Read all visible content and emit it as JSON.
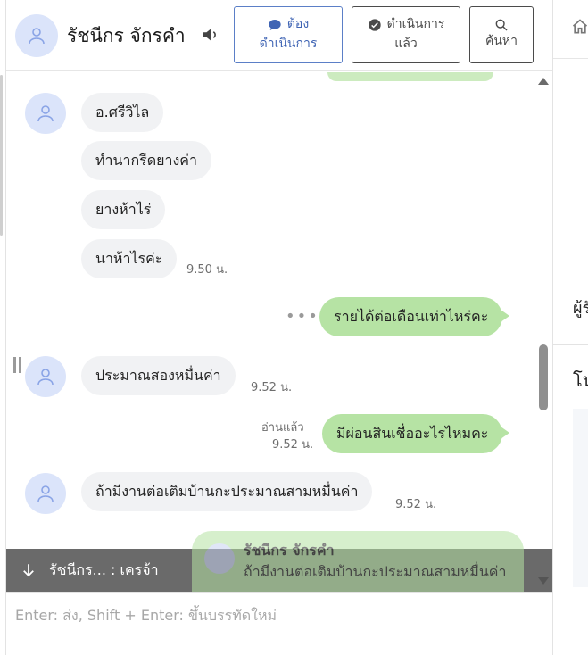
{
  "header": {
    "contact_name": "รัชนีกร จักรคำ",
    "btn_todo_line1": "ต้อง",
    "btn_todo_line2": "ดำเนินการ",
    "btn_done_line1": "ดำเนินการ",
    "btn_done_line2": "แล้ว",
    "btn_search_label": "ค้นหา"
  },
  "right_panel": {
    "label1": "ผู้รั",
    "label2": "โน"
  },
  "messages": [
    {
      "side": "in",
      "text": "อ.ศรีวิไล"
    },
    {
      "side": "in",
      "text": "ทำนากรีดยางค่า"
    },
    {
      "side": "in",
      "text": "ยางห้าไร่"
    },
    {
      "side": "in",
      "text": "นาห้าไรค่ะ",
      "time": "9.50 น."
    },
    {
      "side": "out",
      "text": "รายได้ต่อเดือนเท่าไหร่คะ",
      "more": "•••"
    },
    {
      "side": "in",
      "text": "ประมาณสองหมื่นค่า",
      "time": "9.52 น."
    },
    {
      "side": "out",
      "text": "มีผ่อนสินเชื่ออะไรไหมคะ",
      "read": "อ่านแล้ว",
      "time": "9.52 น."
    },
    {
      "side": "in",
      "text": "ถ้ามีงานต่อเติมบ้านกะประมาณสามหมื่นค่า",
      "time": "9.52 น."
    }
  ],
  "reply_bar": {
    "text": "รัชนีกร... : เครจ้า",
    "preview_name": "รัชนีกร จักรคำ",
    "preview_text": "ถ้ามีงานต่อเติมบ้านกะประมาณสามหมื่นค่า"
  },
  "input": {
    "placeholder": "Enter: ส่ง, Shift + Enter: ขึ้นบรรทัดใหม่"
  },
  "colors": {
    "incoming_bubble": "#f1f2f4",
    "outgoing_bubble": "#b6e3a4",
    "avatar_bg": "#dbe4fa",
    "accent": "#3f64b4"
  },
  "icons": {
    "avatar": "user-icon",
    "speaker": "speaker-icon",
    "todo": "chat-bubble-icon",
    "done": "check-circle-icon",
    "search": "search-icon",
    "home": "home-icon",
    "reply_arrow": "arrow-down-icon"
  }
}
